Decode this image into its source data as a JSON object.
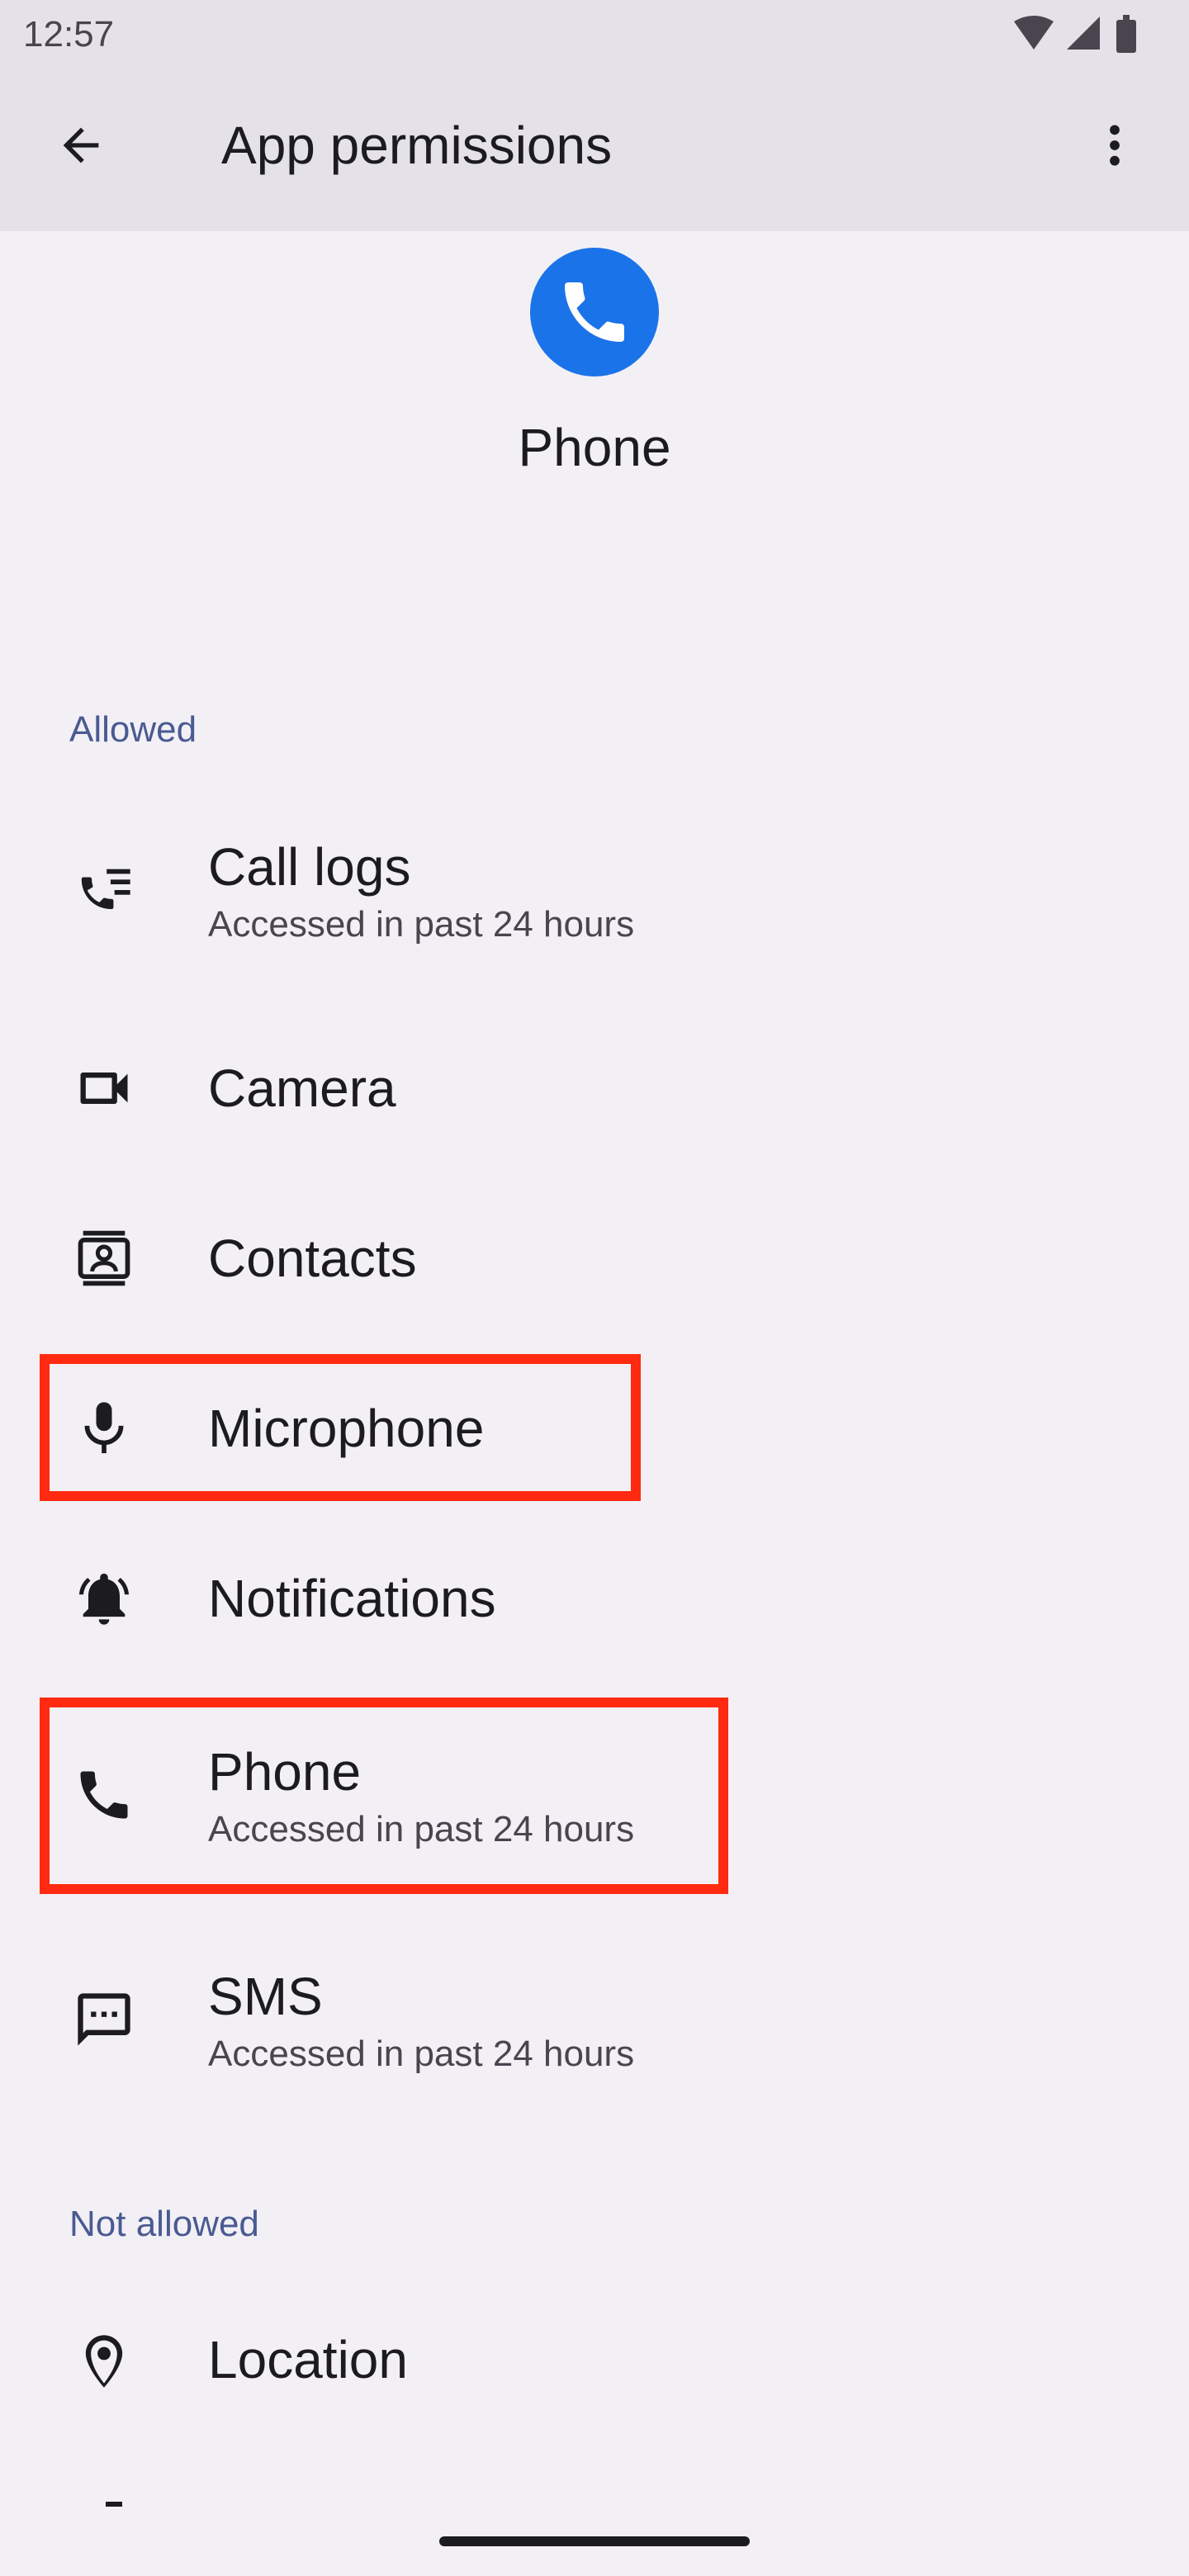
{
  "status_bar": {
    "time": "12:57",
    "icons": [
      "wifi-icon",
      "signal-icon",
      "battery-icon"
    ]
  },
  "app_bar": {
    "title": "App permissions",
    "back_icon": "arrow-back-icon",
    "more_icon": "more-vert-icon"
  },
  "app": {
    "name": "Phone",
    "icon": "phone-app-icon",
    "icon_color": "#1A73E8"
  },
  "sections": {
    "allowed": "Allowed",
    "not_allowed": "Not allowed"
  },
  "permissions": {
    "call_logs": {
      "label": "Call logs",
      "sub": "Accessed in past 24 hours",
      "icon": "call-log-icon"
    },
    "camera": {
      "label": "Camera",
      "icon": "camera-icon"
    },
    "contacts": {
      "label": "Contacts",
      "icon": "contacts-icon"
    },
    "microphone": {
      "label": "Microphone",
      "icon": "microphone-icon",
      "highlighted": true
    },
    "notifications": {
      "label": "Notifications",
      "icon": "notifications-icon"
    },
    "phone": {
      "label": "Phone",
      "sub": "Accessed in past 24 hours",
      "icon": "phone-icon",
      "highlighted": true
    },
    "sms": {
      "label": "SMS",
      "sub": "Accessed in past 24 hours",
      "icon": "sms-icon"
    },
    "location": {
      "label": "Location",
      "icon": "location-icon"
    }
  },
  "colors": {
    "background": "#F2F0F5",
    "app_bar": "#E4E2E8",
    "section_header": "#4A5A92",
    "highlight": "#FF2A0F"
  }
}
